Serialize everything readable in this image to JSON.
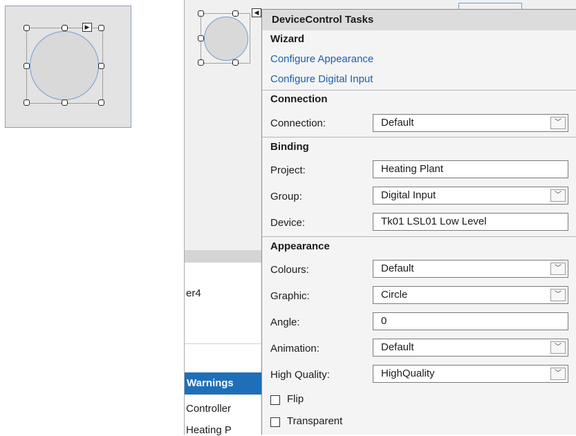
{
  "panel": {
    "title": "DeviceControl Tasks",
    "wizard": {
      "heading": "Wizard",
      "links": [
        "Configure Appearance",
        "Configure Digital Input"
      ]
    },
    "connection": {
      "heading": "Connection",
      "connection_label": "Connection:",
      "connection_value": "Default"
    },
    "binding": {
      "heading": "Binding",
      "project_label": "Project:",
      "project_value": "Heating Plant",
      "group_label": "Group:",
      "group_value": "Digital Input",
      "device_label": "Device:",
      "device_value": "Tk01 LSL01 Low Level"
    },
    "appearance": {
      "heading": "Appearance",
      "colours_label": "Colours:",
      "colours_value": "Default",
      "graphic_label": "Graphic:",
      "graphic_value": "Circle",
      "angle_label": "Angle:",
      "angle_value": "0",
      "animation_label": "Animation:",
      "animation_value": "Default",
      "quality_label": "High Quality:",
      "quality_value": "HighQuality",
      "flip_label": "Flip",
      "flip_checked": false,
      "transparent_label": "Transparent",
      "transparent_checked": false
    }
  },
  "background": {
    "side_text_1": "er4",
    "warnings_tab": "Warnings",
    "side_text_2": "Controller",
    "side_text_3": "Heating P"
  },
  "icons": {
    "smart_tag_open": "▶",
    "smart_tag_close": "◀",
    "dropdown": "﹀"
  },
  "colors": {
    "accent": "#1f6fb8",
    "link": "#1a5fb4",
    "circle_stroke": "#6f9fd1"
  }
}
